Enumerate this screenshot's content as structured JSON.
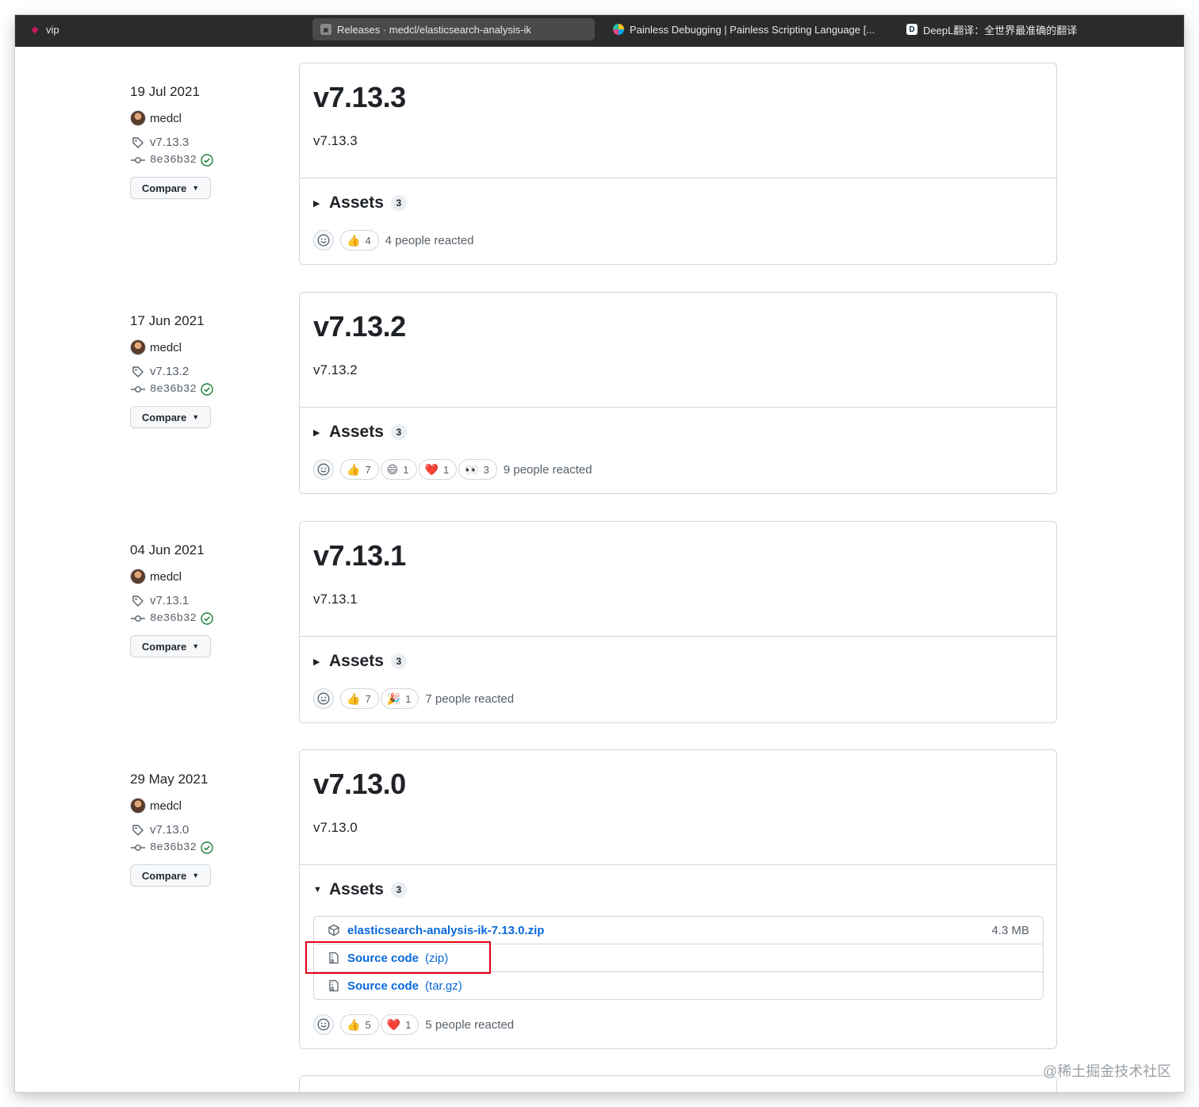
{
  "browser": {
    "tabs": [
      {
        "label": "vip",
        "icon": "vip-icon"
      },
      {
        "label": "Releases · medcl/elasticsearch-analysis-ik",
        "icon": "github-icon",
        "active": true
      },
      {
        "label": "Painless Debugging | Painless Scripting Language [...",
        "icon": "elastic-icon"
      },
      {
        "label": "DeepL翻译：全世界最准确的翻译",
        "icon": "deepl-icon"
      }
    ]
  },
  "releases": [
    {
      "date": "19 Jul 2021",
      "author": "medcl",
      "tag": "v7.13.3",
      "commit": "8e36b32",
      "compare_label": "Compare",
      "title": "v7.13.3",
      "body": "v7.13.3",
      "assets_label": "Assets",
      "assets_count": "3",
      "expanded": false,
      "reactions": [
        {
          "emoji": "👍",
          "count": "4"
        }
      ],
      "reaction_summary": "4 people reacted"
    },
    {
      "date": "17 Jun 2021",
      "author": "medcl",
      "tag": "v7.13.2",
      "commit": "8e36b32",
      "compare_label": "Compare",
      "title": "v7.13.2",
      "body": "v7.13.2",
      "assets_label": "Assets",
      "assets_count": "3",
      "expanded": false,
      "reactions": [
        {
          "emoji": "👍",
          "count": "7"
        },
        {
          "emoji": "😄",
          "count": "1"
        },
        {
          "emoji": "❤️",
          "count": "1"
        },
        {
          "emoji": "👀",
          "count": "3"
        }
      ],
      "reaction_summary": "9 people reacted"
    },
    {
      "date": "04 Jun 2021",
      "author": "medcl",
      "tag": "v7.13.1",
      "commit": "8e36b32",
      "compare_label": "Compare",
      "title": "v7.13.1",
      "body": "v7.13.1",
      "assets_label": "Assets",
      "assets_count": "3",
      "expanded": false,
      "reactions": [
        {
          "emoji": "👍",
          "count": "7"
        },
        {
          "emoji": "🎉",
          "count": "1"
        }
      ],
      "reaction_summary": "7 people reacted"
    },
    {
      "date": "29 May 2021",
      "author": "medcl",
      "tag": "v7.13.0",
      "commit": "8e36b32",
      "compare_label": "Compare",
      "title": "v7.13.0",
      "body": "v7.13.0",
      "assets_label": "Assets",
      "assets_count": "3",
      "expanded": true,
      "assets": [
        {
          "name": "elasticsearch-analysis-ik-7.13.0.zip",
          "kind": "",
          "size": "4.3 MB",
          "icon": "package-icon"
        },
        {
          "name": "Source code",
          "kind": "(zip)",
          "size": "",
          "icon": "file-zip-icon"
        },
        {
          "name": "Source code",
          "kind": "(tar.gz)",
          "size": "",
          "icon": "file-zip-icon"
        }
      ],
      "reactions": [
        {
          "emoji": "👍",
          "count": "5"
        },
        {
          "emoji": "❤️",
          "count": "1"
        }
      ],
      "reaction_summary": "5 people reacted"
    }
  ],
  "watermark": "@稀土掘金技术社区",
  "colors": {
    "link": "#0969da",
    "highlight": "#e60012",
    "verified": "#1a7f37"
  }
}
